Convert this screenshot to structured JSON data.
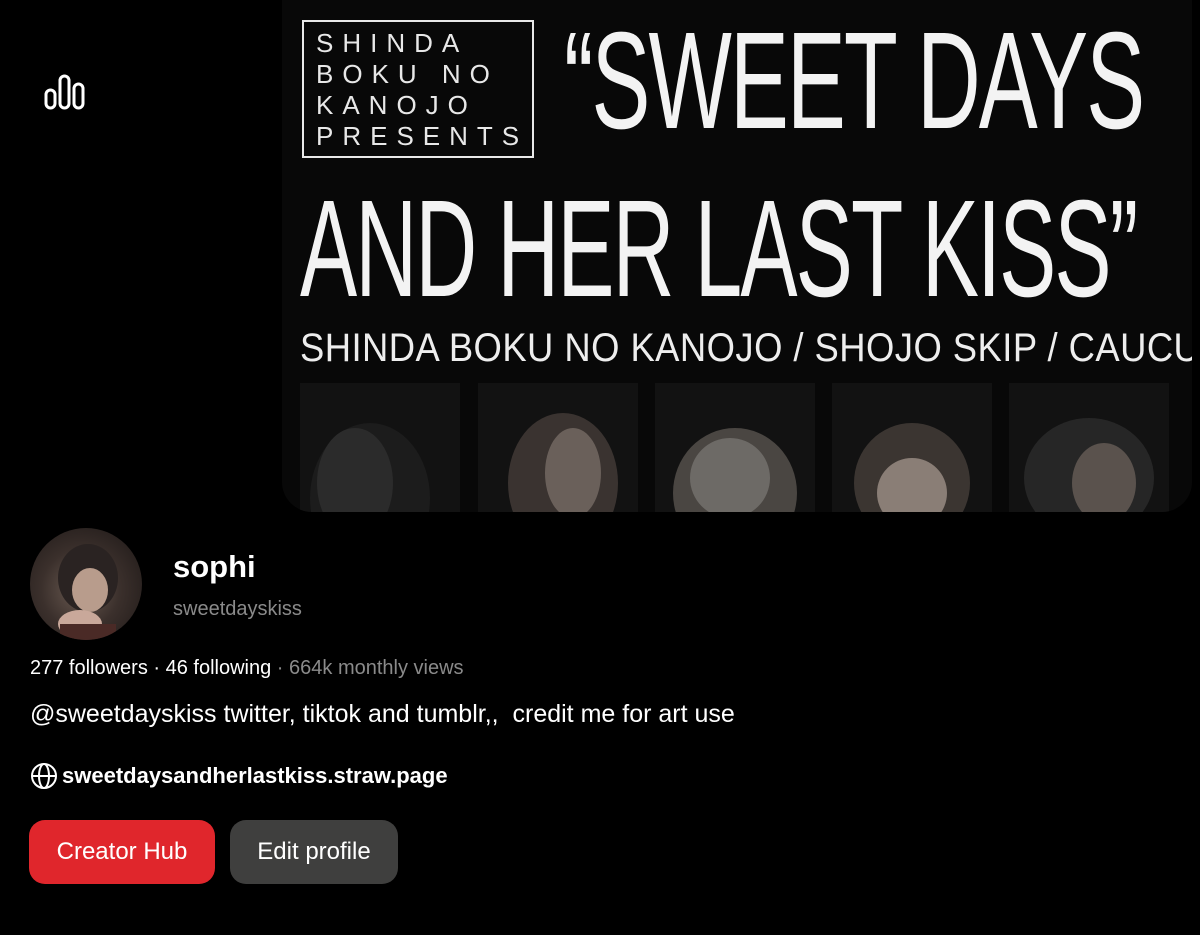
{
  "cover": {
    "presents_lines": [
      "SHINDA",
      "BOKU NO",
      "KANOJO",
      "PRESENTS"
    ],
    "title_line1": "“SWEET DAYS",
    "title_line2": "AND HER LAST KISS”",
    "bands": "SHINDA BOKU NO KANOJO / SHOJO SKIP / CAUCUS"
  },
  "profile": {
    "display_name": "sophi",
    "username": "sweetdayskiss",
    "followers": "277 followers",
    "sep1": " · ",
    "following": "46 following",
    "sep2": " · ",
    "monthly_views": "664k monthly views",
    "bio": "@sweetdayskiss twitter, tiktok and tumblr,,  credit me for art use",
    "website": "sweetdaysandherlastkiss.straw.page"
  },
  "buttons": {
    "creator_hub": "Creator Hub",
    "edit_profile": "Edit profile"
  },
  "icons": {
    "stats": "stats-icon",
    "globe": "globe-icon"
  },
  "colors": {
    "background": "#000000",
    "accent_red": "#e0262c",
    "button_gray": "#3f3f3e",
    "muted_text": "#8a8a8a"
  }
}
